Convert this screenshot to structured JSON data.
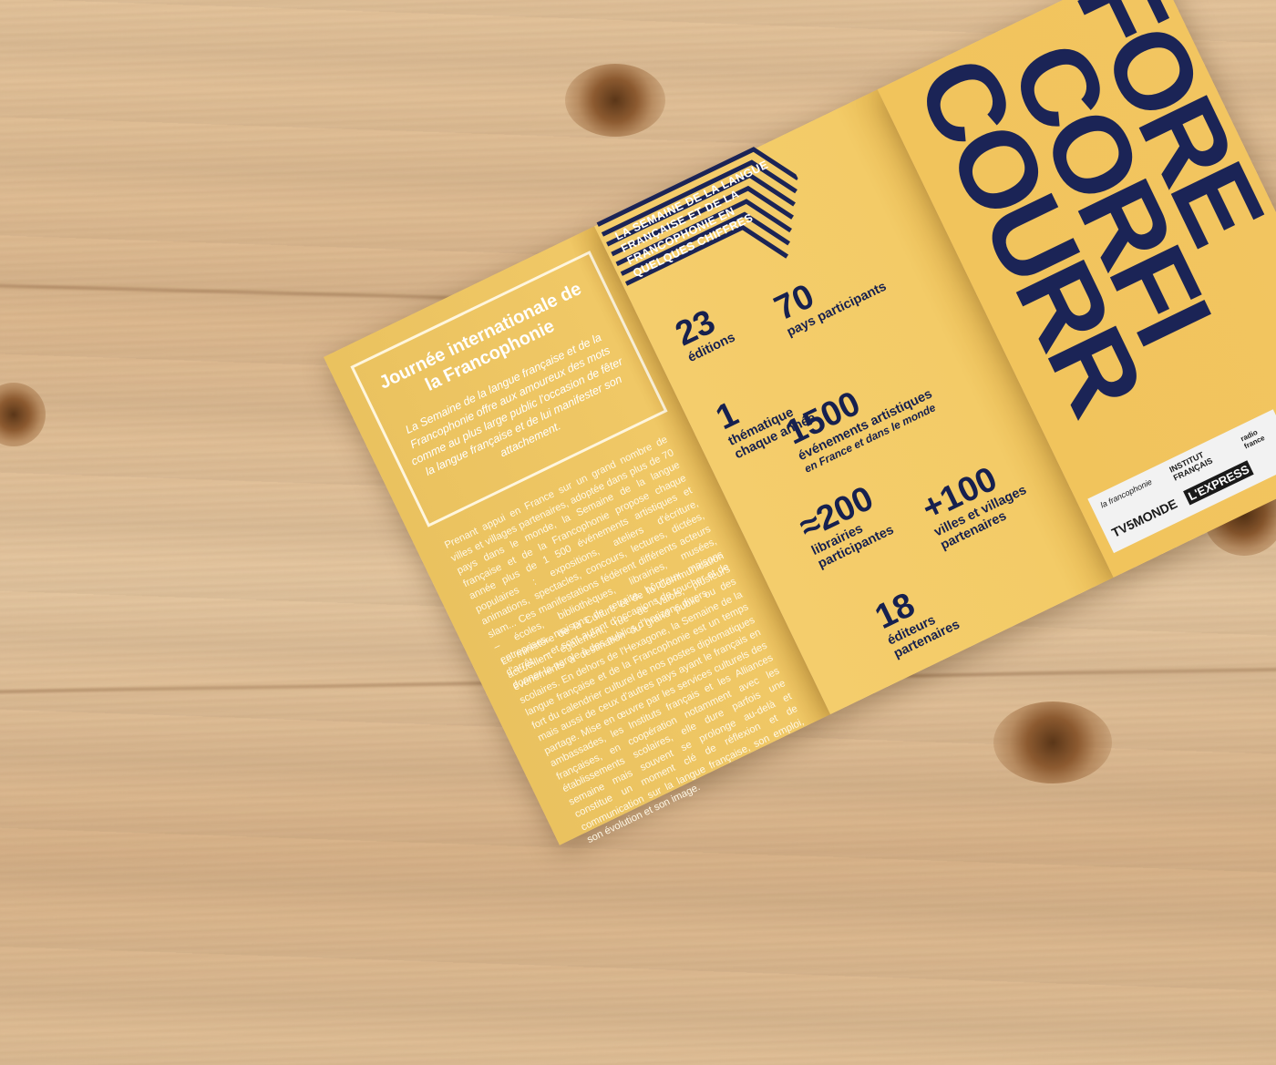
{
  "left_panel": {
    "title": "Journée internationale de la Francophonie",
    "intro": "La Semaine de la langue française et de la Francophonie offre aux amoureux des mots comme au plus large public l'occasion de fêter la langue française et de lui manifester son attachement.",
    "paragraph_1": "Prenant appui en France sur un grand nombre de villes et villages partenaires, adoptée dans plus de 70 pays dans le monde, la Semaine de la langue française et de la Francophonie propose chaque année plus de 1 500 événements artistiques et populaires : expositions, ateliers d'écriture, animations, spectacles, concours, lectures, dictées, slam... Ces manifestations fédèrent différents acteurs – écoles, bibliothèques, librairies, musées, entreprises, maisons de retraite, hôpitaux, maisons d'arrêt... – et sont autant d'occasions de toucher et de donner la parole à des publics d'horizons divers.",
    "paragraph_2": "Le ministère de la Culture et de la Communication accueillent également, rue de Valois, plusieurs événements à destination du grand public ou des scolaires. En dehors de l'Hexagone, la Semaine de la langue française et de la Francophonie est un temps fort du calendrier culturel de nos postes diplomatiques mais aussi de ceux d'autres pays ayant le français en partage. Mise en œuvre par les services culturels des ambassades, les Instituts français et les Alliances françaises, en coopération notamment avec les établissements scolaires, elle dure parfois une semaine mais souvent se prolonge au-delà et constitue un moment clé de réflexion et de communication sur la langue française, son emploi, son évolution et son image."
  },
  "middle_panel": {
    "heading": "LA SEMAINE DE LA LANGUE FRANÇAISE ET DE LA FRANCOPHONIE EN QUELQUES CHIFFRES",
    "stats": [
      {
        "number": "23",
        "label": "éditions"
      },
      {
        "number": "70",
        "label": "pays participants"
      },
      {
        "number": "1",
        "label": "thématique chaque année"
      },
      {
        "number": "1500",
        "label": "événements artistiques",
        "sub": "en France et dans le monde"
      },
      {
        "number": "≈200",
        "label": "librairies participantes"
      },
      {
        "number": "+100",
        "label": "villes et villages partenaires"
      },
      {
        "number": "18",
        "label": "éditeurs partenaires"
      }
    ]
  },
  "right_panel": {
    "big_text": [
      "COURR",
      "CORFI",
      "FORE"
    ],
    "logos": [
      "la francophonie",
      "INSTITUT FRANÇAIS",
      "TV5MONDE",
      "L'EXPRESS",
      "radio france"
    ]
  },
  "colors": {
    "paper": "#f0c460",
    "navy": "#16204f",
    "wood": "#dfbe96",
    "white_text": "#ffffff"
  }
}
